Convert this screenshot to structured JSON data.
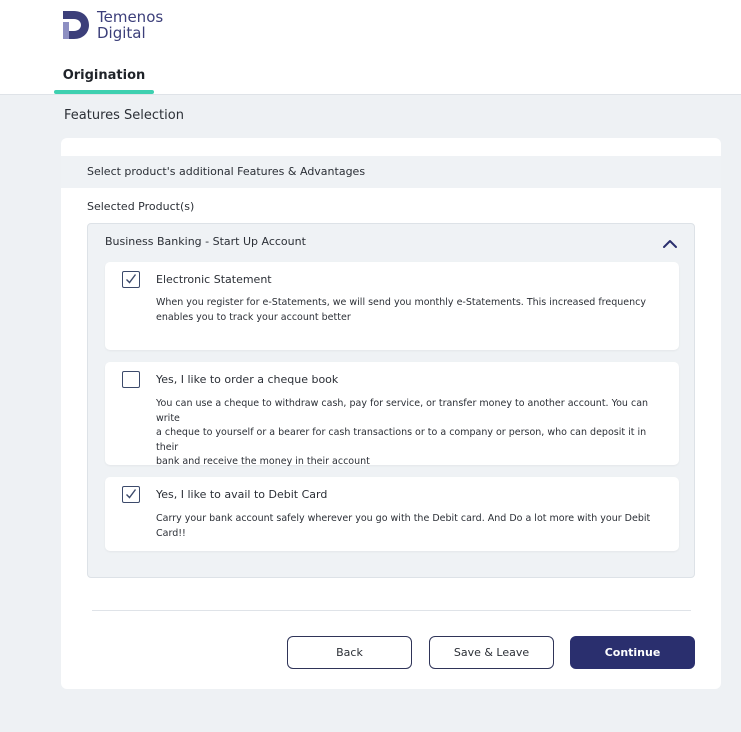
{
  "brand": {
    "line1": "Temenos",
    "line2": "Digital",
    "color": "#3c3f7a"
  },
  "nav": {
    "active_tab": "Origination",
    "accent_color": "#3ed0b0"
  },
  "page": {
    "title": "Features Selection"
  },
  "card": {
    "subtitle": "Select product's additional Features & Advantages",
    "selected_label": "Selected Product(s)"
  },
  "product": {
    "name": "Business Banking - Start Up Account",
    "expanded": true,
    "features": [
      {
        "title": "Electronic Statement",
        "checked": true,
        "desc_lines": [
          "When you register for e-Statements, we will send you monthly e-Statements. This increased frequency",
          "enables you to track your account better"
        ]
      },
      {
        "title": "Yes, I like to order a cheque book",
        "checked": false,
        "desc_lines": [
          "You can use a cheque to withdraw cash, pay for service, or transfer money to another account. You can write",
          "a cheque to yourself or a bearer for cash transactions or to a company or person, who can deposit it in their",
          "bank and receive the money in their account"
        ]
      },
      {
        "title": "Yes, I like to avail to Debit Card",
        "checked": true,
        "desc_lines": [
          "Carry your bank account safely wherever you go with the Debit card. And Do a lot more with your Debit Card!!"
        ]
      }
    ]
  },
  "actions": {
    "back_label": "Back",
    "save_label": "Save & Leave",
    "continue_label": "Continue",
    "primary_color": "#2a2f6e"
  }
}
